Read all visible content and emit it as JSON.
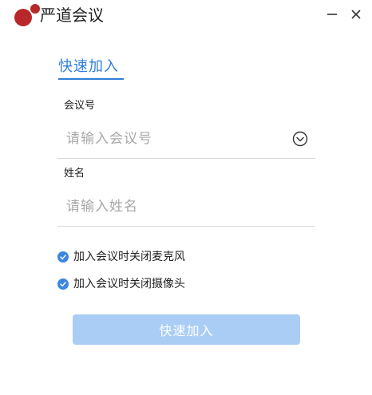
{
  "app": {
    "title": "严道会议"
  },
  "window_controls": {
    "minimize_icon": "minus-icon",
    "close_icon": "close-icon"
  },
  "tab": {
    "label": "快速加入"
  },
  "meeting_field": {
    "label": "会议号",
    "placeholder": "请输入会议号",
    "value": "",
    "dropdown_icon": "chevron-down-circle-icon"
  },
  "name_field": {
    "label": "姓名",
    "placeholder": "请输入姓名",
    "value": ""
  },
  "options": [
    {
      "label": "加入会议时关闭麦克风",
      "checked": true
    },
    {
      "label": "加入会议时关闭摄像头",
      "checked": true
    }
  ],
  "join_button": {
    "label": "快速加入",
    "enabled": false
  },
  "colors": {
    "accent": "#2f7fd8",
    "checkbox": "#3a86e0",
    "button_disabled": "#aacdf5",
    "logo_red": "#b52a2a"
  }
}
